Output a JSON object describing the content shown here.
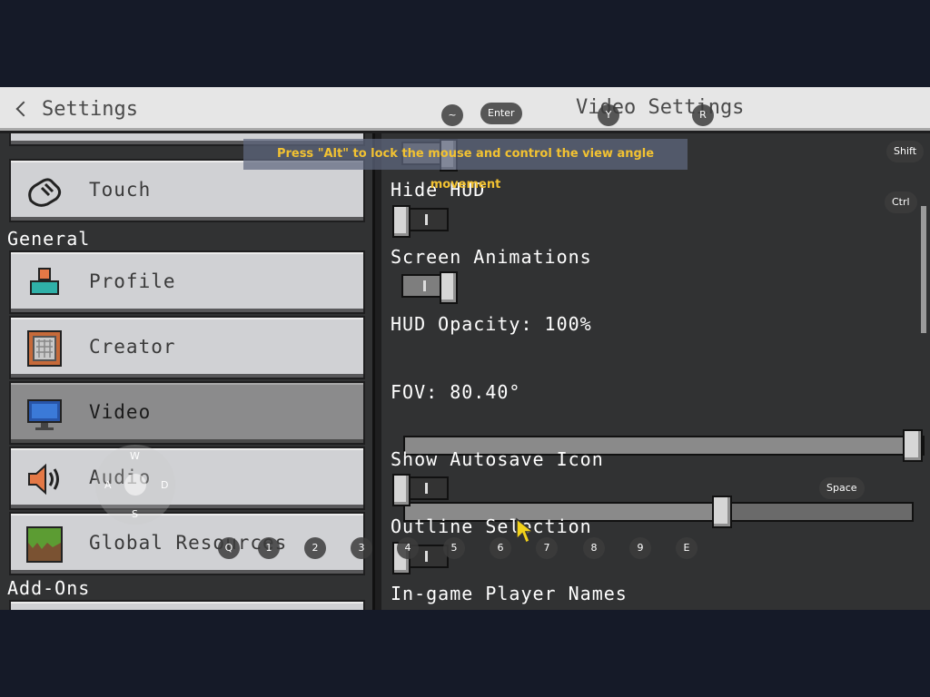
{
  "header": {
    "back_label": "Settings",
    "title": "Video Settings"
  },
  "sidebar": {
    "items_top": [
      {
        "label": "Touch",
        "icon": "touch-icon"
      }
    ],
    "section_general": "General",
    "items_general": [
      {
        "label": "Profile",
        "icon": "profile-icon"
      },
      {
        "label": "Creator",
        "icon": "creator-icon"
      },
      {
        "label": "Video",
        "icon": "monitor-icon",
        "selected": true
      },
      {
        "label": "Audio",
        "icon": "speaker-icon"
      },
      {
        "label": "Global Resources",
        "icon": "grass-block-icon"
      }
    ],
    "section_addons": "Add-Ons"
  },
  "settings": {
    "hide_hud": {
      "label": "Hide HUD",
      "on": false
    },
    "screen_animations": {
      "label": "Screen Animations",
      "on": true
    },
    "hud_opacity": {
      "label": "HUD Opacity: 100%",
      "value": 1.0
    },
    "fov": {
      "label": "FOV: 80.40°",
      "value": 0.63
    },
    "show_autosave_icon": {
      "label": "Show Autosave Icon",
      "on": false
    },
    "outline_selection": {
      "label": "Outline Selection",
      "on": false
    },
    "ingame_player_names": {
      "label": "In-game Player Names"
    }
  },
  "overlay": {
    "banner": "Press \"Alt\" to lock the mouse and control the view angle movement",
    "keys": {
      "tilde": "~",
      "enter": "Enter",
      "y": "Y",
      "r": "R",
      "shift": "Shift",
      "ctrl": "Ctrl",
      "space": "Space",
      "q": "Q",
      "k1": "1",
      "k2": "2",
      "k3": "3",
      "k4": "4",
      "k5": "5",
      "k6": "6",
      "k7": "7",
      "k8": "8",
      "k9": "9",
      "e": "E"
    },
    "joystick": {
      "w": "W",
      "a": "A",
      "s": "S",
      "d": "D"
    }
  },
  "colors": {
    "panel": "#313233",
    "button": "#d0d1d4",
    "selected": "#8b8b8c",
    "banner_text": "#f2c232"
  }
}
